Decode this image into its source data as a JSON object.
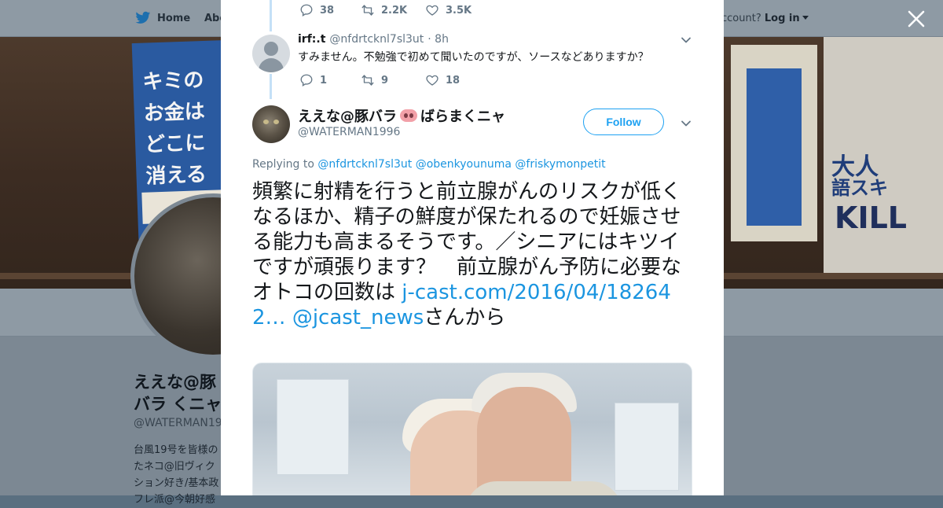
{
  "background_page": {
    "nav": {
      "home": "Home",
      "about": "Abo",
      "account_prompt": "ccount?",
      "login": "Log in"
    },
    "banner_book_left": [
      "キミの",
      "お金は",
      "どこに",
      "消える"
    ],
    "banner_book_right": {
      "line1": "大人",
      "line2": "語スキ",
      "line3": "KILL"
    },
    "profile_name": "ええな@豚バラ くニャ",
    "profile_handle": "@WATERMAN199",
    "profile_bio": "台風19号を皆様の たネコ@旧ヴィク ション好き/基本政 フレ派@今朝好感"
  },
  "previous_tweet_actions": {
    "replies": "38",
    "retweets": "2.2K",
    "likes": "3.5K"
  },
  "reply_tweet": {
    "name": "irf:.t",
    "handle": "@nfdrtcknl7sl3ut",
    "time": "· 8h",
    "text": "すみません。不勉強で初めて聞いたのですが、ソースなどありますか？",
    "replies": "1",
    "retweets": "9",
    "likes": "18"
  },
  "main_tweet": {
    "name_part1": "ええな@豚バラ",
    "name_part2": "ばらまくニャ",
    "handle": "@WATERMAN1996",
    "follow_label": "Follow",
    "replying_prefix": "Replying to",
    "replying_to": [
      "@nfdrtcknl7sl3ut",
      "@obenkyounuma",
      "@friskymonpetit"
    ],
    "text_body": "頻繁に射精を行うと前立腺がんのリスクが低くなるほか、精子の鮮度が保たれるので妊娠させる能力も高まるそうです。／シニアにはキツイですが頑張ります？　前立腺がん予防に必要なオトコの回数は ",
    "link": "j-cast.com/2016/04/182642…",
    "mention": "@jcast_news",
    "text_tail": "さんから"
  },
  "colors": {
    "accent": "#1da1f2",
    "text": "#14171a",
    "muted": "#657786",
    "thread": "#c4e0f7"
  },
  "icons": [
    "twitter-bird-icon",
    "close-icon",
    "reply-icon",
    "retweet-icon",
    "like-icon",
    "chevron-down-icon"
  ]
}
